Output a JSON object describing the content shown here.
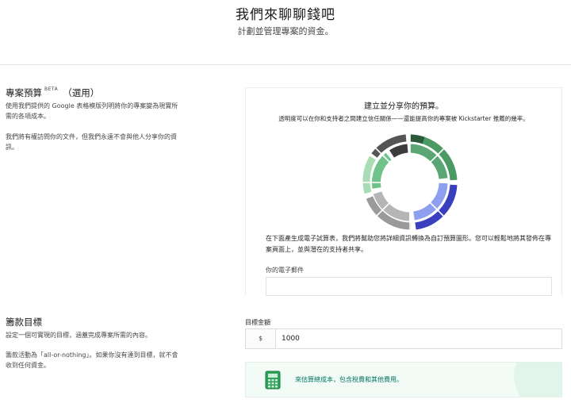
{
  "hero": {
    "title": "我們來聊聊錢吧",
    "subtitle": "計劃並管理專案的資金。"
  },
  "budget": {
    "title": "專案預算",
    "beta": "BETA",
    "optional": "（選用）",
    "para1": "使用我們提供的 Google 表格模版列明將你的專案變為現實所需的各項成本。",
    "para2": "我們將有權訪問你的文件，但我們永遠不會與他人分享你的資訊。",
    "card": {
      "title": "建立並分享你的預算。",
      "subtitle": "透明度可以在你和支持者之間建立信任關係——還能提高你的專案被 Kickstarter 推薦的幾率。",
      "description": "在下面產生成電子試算表，我們將幫助您將詳細資訊轉換為自訂預算圖形。您可以輕鬆地將其發佈在專案頁面上，並與潛在的支持者共享。",
      "email_label": "你的電子郵件",
      "email_value": ""
    }
  },
  "goal": {
    "title": "籌款目標",
    "para1": "設定一個可實現的目標，涵蓋完成專案所需的內容。",
    "para2": "籌款活動為「all-or-nothing」。如果你沒有達到目標，就不會收到任何資金。",
    "amount_label": "目標金額",
    "currency": "$",
    "amount_value": "1000",
    "banner_text": "來估算總成本，包含稅費和其他費用。"
  },
  "colors": {
    "accent_green": "#037362",
    "banner_bg": "#f2fbf6"
  },
  "icons": {
    "banner": "calculator-icon",
    "card_graphic": "budget-donut-illustration"
  }
}
